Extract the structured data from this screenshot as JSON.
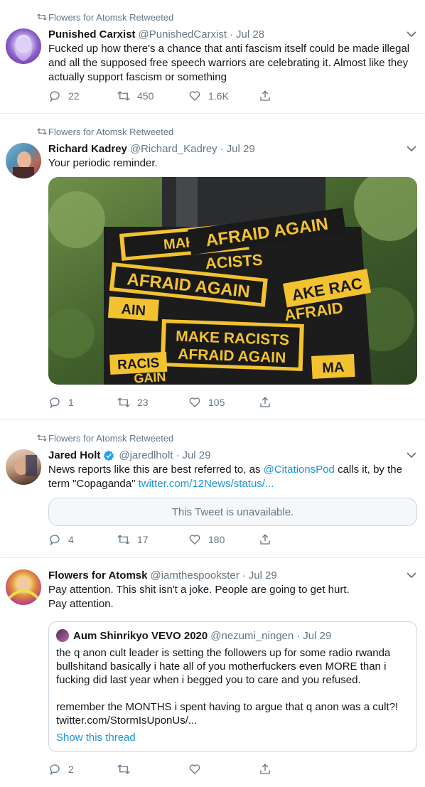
{
  "tweets": [
    {
      "retweeted_by": "Flowers for Atomsk Retweeted",
      "name": "Punished Carxist",
      "handle": "@PunishedCarxist",
      "dot": "·",
      "date": "Jul 28",
      "text": "Fucked up how there's a chance that anti fascism itself could be made illegal and all the supposed free speech warriors are celebrating it. Almost like they actually support fascism or something",
      "replies": "22",
      "retweets": "450",
      "likes": "1.6K"
    },
    {
      "retweeted_by": "Flowers for Atomsk Retweeted",
      "name": "Richard Kadrey",
      "handle": "@Richard_Kadrey",
      "dot": "·",
      "date": "Jul 29",
      "text": "Your periodic reminder.",
      "photo": {
        "sticker_top_1": "AFRAID AGAIN",
        "sticker_top_2": "MAKE",
        "sticker_top_3": "ACISTS",
        "sticker_mid": "AFRAID AGAIN",
        "sticker_main_1": "MAKE RACISTS",
        "sticker_main_2": "AFRAID AGAIN",
        "sticker_right_1": "AKE RAC",
        "sticker_right_2": "AFRAID",
        "sticker_left_1": "AIN",
        "sticker_left_2": "RACIS",
        "sticker_left_3": "GAIN",
        "sticker_ma": "MA"
      },
      "replies": "1",
      "retweets": "23",
      "likes": "105"
    },
    {
      "retweeted_by": "Flowers for Atomsk Retweeted",
      "name": "Jared Holt",
      "verified_icon": "verified-badge",
      "handle": "@jaredlholt",
      "dot": "·",
      "date": "Jul 29",
      "text_before": "News reports like this are best referred to, as ",
      "mention": "@CitationsPod",
      "text_middle": " calls it, by the term \"Copaganda\" ",
      "link": "twitter.com/12News/status/...",
      "unavailable": "This Tweet is unavailable.",
      "replies": "4",
      "retweets": "17",
      "likes": "180"
    },
    {
      "name": "Flowers for Atomsk",
      "handle": "@iamthespookster",
      "dot": "·",
      "date": "Jul 29",
      "text": "Pay attention. This shit isn't a joke. People are going to get hurt.\nPay attention.",
      "quote": {
        "name": "Aum Shinrikyo VEVO 2020",
        "handle": "@nezumi_ningen",
        "dot": "·",
        "date": "Jul 29",
        "text": "the q anon cult leader is setting the followers up for some radio rwanda bullshitand basically i hate all of you motherfuckers even MORE than i fucking did last year when i begged you to care and you refused.\n\nremember the MONTHS i spent having to argue that q anon was a cult?! twitter.com/StormIsUponUs/...",
        "show_thread": "Show this thread"
      },
      "replies": "2"
    }
  ],
  "colors": {
    "link": "#1b95e0",
    "secondary": "#657786",
    "border": "#e6ecf0",
    "verified": "#1da1f2",
    "sticker_yellow": "#f2c230",
    "sticker_black": "#1a1a1a"
  }
}
